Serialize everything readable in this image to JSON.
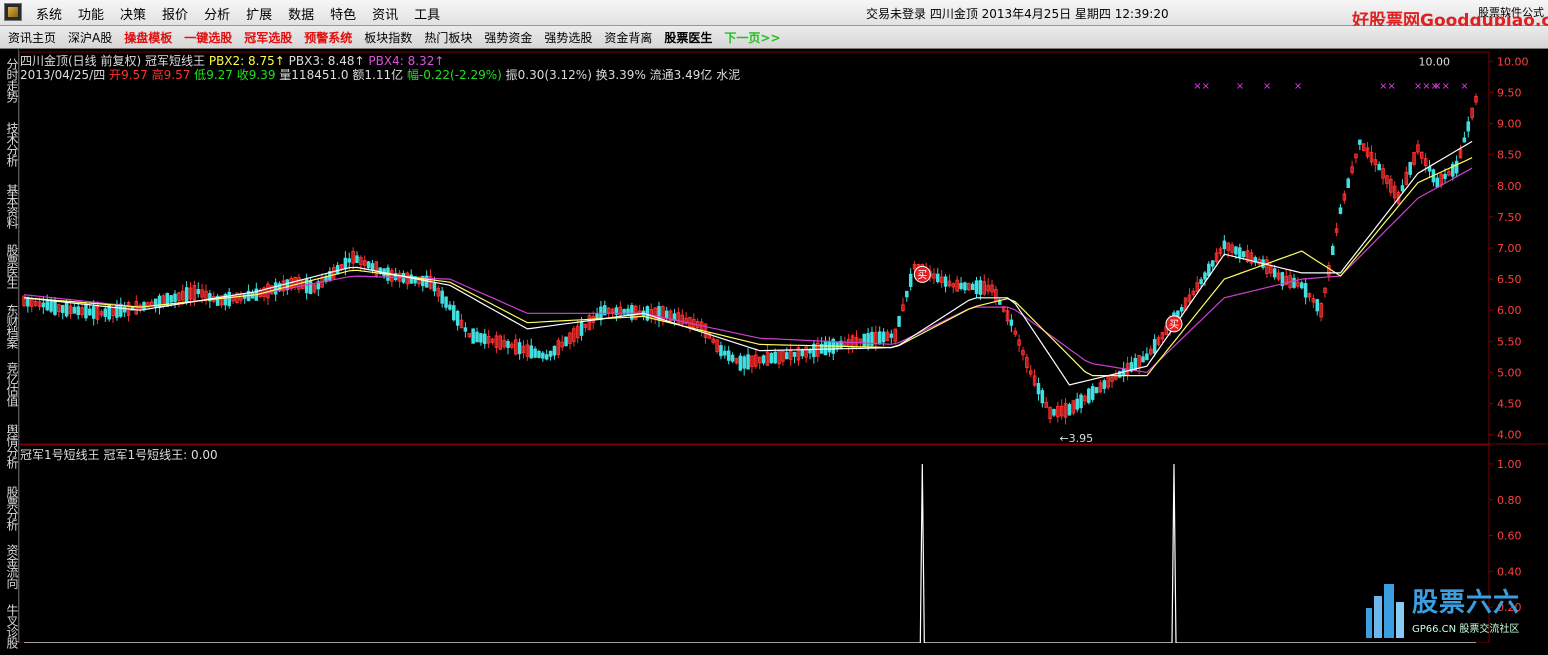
{
  "menubar": {
    "items": [
      "系统",
      "功能",
      "决策",
      "报价",
      "分析",
      "扩展",
      "数据",
      "特色",
      "资讯",
      "工具"
    ],
    "status": "交易未登录  四川金顶  2013年4月25日  星期四  12:39:20",
    "brand_site": "好股票网Goodgupiao.com",
    "brand_small": "股票软件公式"
  },
  "navbar": {
    "items": [
      {
        "label": "资讯主页",
        "style": "normal"
      },
      {
        "label": "深沪A股",
        "style": "normal"
      },
      {
        "label": "操盘模板",
        "style": "red"
      },
      {
        "label": "一键选股",
        "style": "red"
      },
      {
        "label": "冠军选股",
        "style": "red"
      },
      {
        "label": "预警系统",
        "style": "red"
      },
      {
        "label": "板块指数",
        "style": "normal"
      },
      {
        "label": "热门板块",
        "style": "normal"
      },
      {
        "label": "强势资金",
        "style": "normal"
      },
      {
        "label": "强势选股",
        "style": "normal"
      },
      {
        "label": "资金背离",
        "style": "normal"
      },
      {
        "label": "股票医生",
        "style": "bold"
      },
      {
        "label": "下一页>>",
        "style": "green"
      }
    ]
  },
  "sidebar": {
    "tabs": [
      "分时走势",
      "技术分析",
      "基本资料",
      "股票医生",
      "东财档案",
      "竞亿估值",
      "舆情分析",
      "股票分析",
      "资金流向",
      "牛叉诊股"
    ]
  },
  "info": {
    "title": "四川金顶(日线 前复权) 冠军短线王",
    "pbx2": "PBX2: 8.75↑",
    "pbx3": "PBX3: 8.48↑",
    "pbx4": "PBX4: 8.32↑",
    "date": "2013/04/25/四",
    "open_label": "开",
    "open": "9.57",
    "high_label": "高",
    "high": "9.57",
    "low_label": "低",
    "low": "9.27",
    "close_label": "收",
    "close": "9.39",
    "vol": "量118451.0",
    "amount": "额1.11亿",
    "change_label": "幅",
    "change": "-0.22(-2.29%)",
    "amplitude": "振0.30(3.12%)",
    "turnover": "换3.39%",
    "float_cap": "流通3.49亿",
    "industry": "水泥",
    "indicator": "冠军1号短线王  冠军1号短线王: 0.00"
  },
  "chart_data": [
    {
      "type": "candlestick",
      "title": "四川金顶(日线 前复权) 冠军短线王",
      "ylim": [
        3.85,
        10.15
      ],
      "yticks": [
        "10.00",
        "9.50",
        "9.00",
        "8.50",
        "8.00",
        "7.50",
        "7.00",
        "6.50",
        "6.00",
        "5.50",
        "5.00",
        "4.50",
        "4.00"
      ],
      "close_path": [
        [
          0,
          6.15
        ],
        [
          10,
          6.02
        ],
        [
          20,
          5.95
        ],
        [
          30,
          6.05
        ],
        [
          45,
          6.3
        ],
        [
          50,
          6.15
        ],
        [
          60,
          6.25
        ],
        [
          70,
          6.45
        ],
        [
          75,
          6.35
        ],
        [
          85,
          6.85
        ],
        [
          90,
          6.7
        ],
        [
          95,
          6.55
        ],
        [
          105,
          6.45
        ],
        [
          110,
          6.05
        ],
        [
          115,
          5.6
        ],
        [
          125,
          5.45
        ],
        [
          135,
          5.25
        ],
        [
          145,
          5.75
        ],
        [
          150,
          6.0
        ],
        [
          160,
          5.95
        ],
        [
          165,
          5.95
        ],
        [
          175,
          5.75
        ],
        [
          180,
          5.35
        ],
        [
          185,
          5.15
        ],
        [
          190,
          5.2
        ],
        [
          200,
          5.3
        ],
        [
          215,
          5.5
        ],
        [
          225,
          5.6
        ],
        [
          230,
          6.7
        ],
        [
          240,
          6.4
        ],
        [
          250,
          6.35
        ],
        [
          255,
          5.8
        ],
        [
          260,
          5.0
        ],
        [
          265,
          4.35
        ],
        [
          270,
          4.4
        ],
        [
          280,
          4.85
        ],
        [
          290,
          5.25
        ],
        [
          300,
          6.1
        ],
        [
          305,
          6.55
        ],
        [
          310,
          7.05
        ],
        [
          320,
          6.75
        ],
        [
          325,
          6.5
        ],
        [
          330,
          6.4
        ],
        [
          335,
          6.0
        ],
        [
          340,
          7.6
        ],
        [
          345,
          8.7
        ],
        [
          350,
          8.3
        ],
        [
          355,
          7.8
        ],
        [
          360,
          8.6
        ],
        [
          365,
          8.05
        ],
        [
          370,
          8.3
        ],
        [
          375,
          9.39
        ]
      ],
      "ma_short": [
        [
          0,
          6.2
        ],
        [
          30,
          6.0
        ],
        [
          60,
          6.3
        ],
        [
          85,
          6.7
        ],
        [
          110,
          6.4
        ],
        [
          130,
          5.7
        ],
        [
          160,
          5.95
        ],
        [
          190,
          5.35
        ],
        [
          225,
          5.4
        ],
        [
          245,
          6.2
        ],
        [
          255,
          6.2
        ],
        [
          270,
          4.8
        ],
        [
          290,
          5.1
        ],
        [
          310,
          6.9
        ],
        [
          330,
          6.6
        ],
        [
          340,
          6.6
        ],
        [
          360,
          8.2
        ],
        [
          375,
          8.75
        ]
      ],
      "ma_mid": [
        [
          0,
          6.2
        ],
        [
          30,
          6.05
        ],
        [
          60,
          6.25
        ],
        [
          85,
          6.65
        ],
        [
          110,
          6.45
        ],
        [
          130,
          5.8
        ],
        [
          160,
          5.9
        ],
        [
          190,
          5.45
        ],
        [
          225,
          5.4
        ],
        [
          245,
          6.05
        ],
        [
          255,
          6.2
        ],
        [
          275,
          4.95
        ],
        [
          290,
          4.95
        ],
        [
          310,
          6.5
        ],
        [
          330,
          6.95
        ],
        [
          340,
          6.55
        ],
        [
          360,
          8.05
        ],
        [
          375,
          8.48
        ]
      ],
      "ma_long": [
        [
          0,
          6.25
        ],
        [
          30,
          6.05
        ],
        [
          60,
          6.25
        ],
        [
          85,
          6.55
        ],
        [
          110,
          6.5
        ],
        [
          130,
          5.95
        ],
        [
          160,
          5.95
        ],
        [
          190,
          5.55
        ],
        [
          225,
          5.45
        ],
        [
          245,
          6.05
        ],
        [
          255,
          6.05
        ],
        [
          275,
          5.15
        ],
        [
          290,
          5.0
        ],
        [
          310,
          6.2
        ],
        [
          330,
          6.5
        ],
        [
          340,
          6.55
        ],
        [
          360,
          7.8
        ],
        [
          375,
          8.32
        ]
      ],
      "buy_signals": [
        {
          "x": 232,
          "label": "买"
        },
        {
          "x": 297,
          "label": "买"
        }
      ],
      "annotations": [
        {
          "text": "←3.95",
          "value": 3.95
        },
        {
          "text": "10.00",
          "value": 10.0
        }
      ],
      "x_marks": [
        "××",
        "×",
        "×",
        "×",
        "××",
        "×××",
        "××",
        "×"
      ]
    },
    {
      "type": "line",
      "series_name": "冠军1号短线王",
      "ylim": [
        0,
        1.05
      ],
      "yticks": [
        "1.00",
        "0.80",
        "0.60",
        "0.40",
        "0.20"
      ],
      "spikes": [
        {
          "x": 232,
          "value": 1.0
        },
        {
          "x": 297,
          "value": 1.0
        }
      ],
      "current": 0.0
    }
  ],
  "watermark": {
    "cn": "股票六六",
    "en": "GP66.CN 股票交流社区"
  },
  "colors": {
    "up": "#ff3030",
    "down": "#40e0e0",
    "ma_short": "#ffffff",
    "ma_mid": "#ffff60",
    "ma_long": "#d040d0",
    "grid": "#7a0000"
  }
}
